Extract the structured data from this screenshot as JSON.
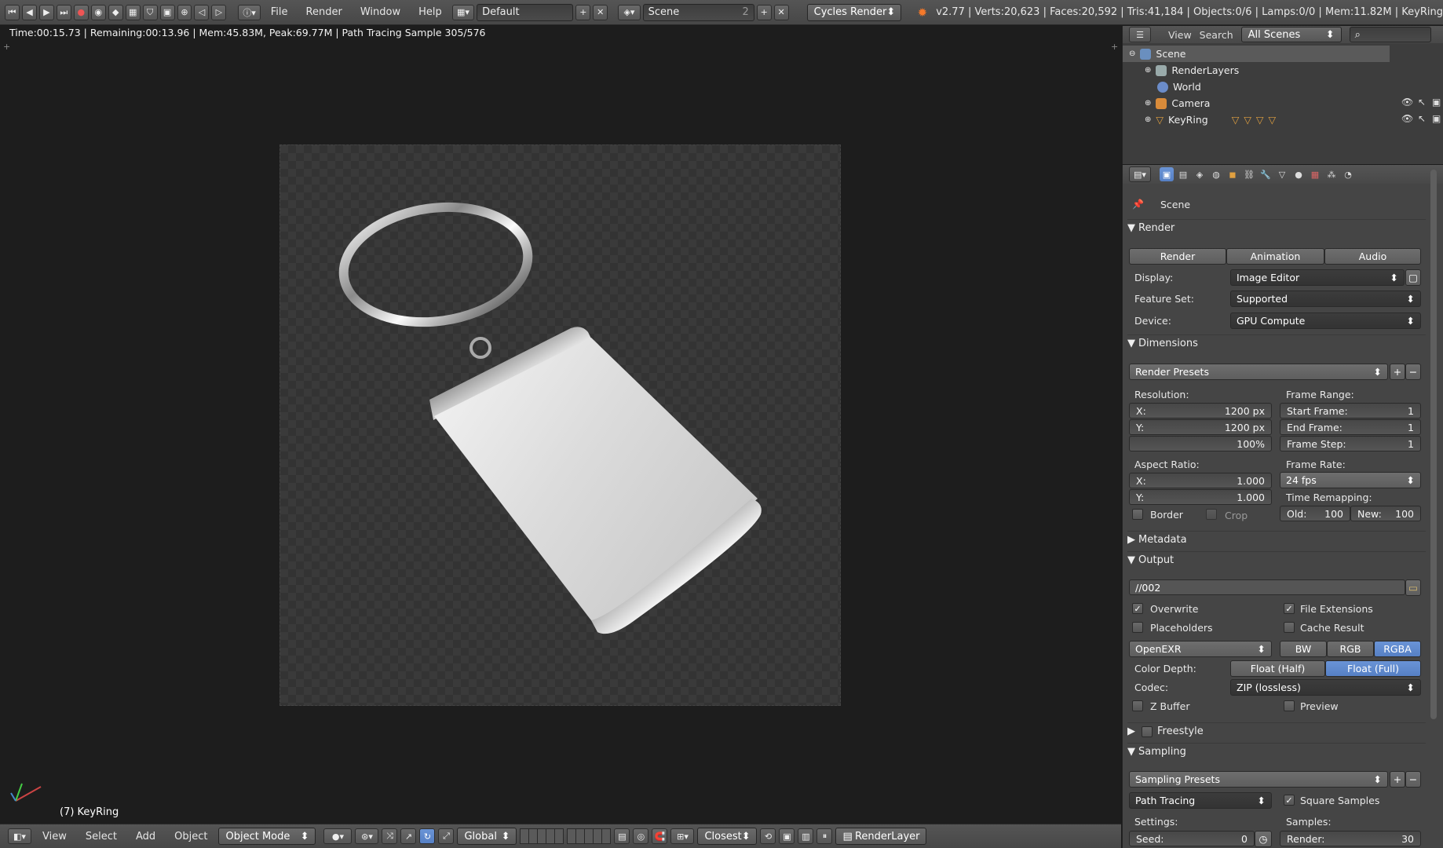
{
  "top_bar": {
    "menus": [
      "File",
      "Render",
      "Window",
      "Help"
    ],
    "layout": "Default",
    "scene": "Scene",
    "scene_count": "2",
    "engine": "Cycles Render",
    "stats": "v2.77 | Verts:20,623 | Faces:20,592 | Tris:41,184 | Objects:0/6 | Lamps:0/0 | Mem:11.82M | KeyRing"
  },
  "viewport": {
    "render_info": "Time:00:15.73 | Remaining:00:13.96 | Mem:45.83M, Peak:69.77M | Path Tracing Sample 305/576",
    "object_label": "(7) KeyRing"
  },
  "bottom_bar": {
    "menus": [
      "View",
      "Select",
      "Add",
      "Object"
    ],
    "mode": "Object Mode",
    "orientation": "Global",
    "snap": "Closest",
    "render_layer": "RenderLayer"
  },
  "outliner": {
    "header": {
      "view": "View",
      "search": "Search",
      "filter": "All Scenes"
    },
    "items": [
      {
        "label": "Scene",
        "icon": "scene-icon"
      },
      {
        "label": "RenderLayers",
        "icon": "renderlayers-icon"
      },
      {
        "label": "World",
        "icon": "world-icon"
      },
      {
        "label": "Camera",
        "icon": "camera-icon"
      },
      {
        "label": "KeyRing",
        "icon": "mesh-icon"
      }
    ]
  },
  "properties": {
    "context": "Scene",
    "render": {
      "title": "Render",
      "buttons": [
        "Render",
        "Animation",
        "Audio"
      ],
      "display_label": "Display:",
      "display": "Image Editor",
      "feature_label": "Feature Set:",
      "feature": "Supported",
      "device_label": "Device:",
      "device": "GPU Compute"
    },
    "dimensions": {
      "title": "Dimensions",
      "presets": "Render Presets",
      "resolution_label": "Resolution:",
      "res_x_label": "X:",
      "res_x": "1200 px",
      "res_y_label": "Y:",
      "res_y": "1200 px",
      "res_pct": "100%",
      "frame_range_label": "Frame Range:",
      "start_label": "Start Frame:",
      "start": "1",
      "end_label": "End Frame:",
      "end": "1",
      "step_label": "Frame Step:",
      "step": "1",
      "aspect_label": "Aspect Ratio:",
      "asp_x_label": "X:",
      "asp_x": "1.000",
      "asp_y_label": "Y:",
      "asp_y": "1.000",
      "frame_rate_label": "Frame Rate:",
      "frame_rate": "24 fps",
      "time_remap_label": "Time Remapping:",
      "old_label": "Old:",
      "old": "100",
      "new_label": "New:",
      "new": "100",
      "border": "Border",
      "crop": "Crop"
    },
    "metadata": {
      "title": "Metadata"
    },
    "output": {
      "title": "Output",
      "path": "//002",
      "overwrite": "Overwrite",
      "file_ext": "File Extensions",
      "placeholders": "Placeholders",
      "cache": "Cache Result",
      "format": "OpenEXR",
      "color_modes": [
        "BW",
        "RGB",
        "RGBA"
      ],
      "depth_label": "Color Depth:",
      "depths": [
        "Float (Half)",
        "Float (Full)"
      ],
      "codec_label": "Codec:",
      "codec": "ZIP (lossless)",
      "zbuffer": "Z Buffer",
      "preview": "Preview"
    },
    "freestyle": {
      "title": "Freestyle"
    },
    "sampling": {
      "title": "Sampling",
      "presets": "Sampling Presets",
      "method": "Path Tracing",
      "square": "Square Samples",
      "settings_label": "Settings:",
      "samples_label": "Samples:",
      "seed_label": "Seed:",
      "seed": "0",
      "render_label": "Render:",
      "render": "30"
    }
  }
}
